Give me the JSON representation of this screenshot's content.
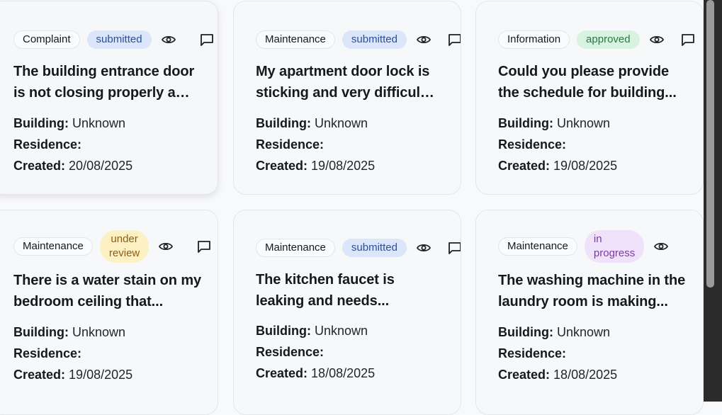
{
  "colors": {
    "submitted_bg": "#dbe6fb",
    "submitted_fg": "#2a4f9c",
    "approved_bg": "#d8f3df",
    "approved_fg": "#2a7a45",
    "under_review_bg": "#fdf1c4",
    "under_review_fg": "#8a5d12",
    "in_progress_bg": "#f1e2fb",
    "in_progress_fg": "#7a3aa5"
  },
  "labels": {
    "building": "Building:",
    "residence": "Residence:",
    "created": "Created:"
  },
  "cards": [
    {
      "category": "Complaint",
      "status": "submitted",
      "title_line1": "The building entrance door",
      "title_line2": "is not closing properly an...",
      "building": "Unknown",
      "residence": "",
      "created": "20/08/2025"
    },
    {
      "category": "Maintenance",
      "status": "submitted",
      "title_line1": "My apartment door lock is",
      "title_line2": "sticking and very difficult ...",
      "building": "Unknown",
      "residence": "",
      "created": "19/08/2025"
    },
    {
      "category": "Information",
      "status": "approved",
      "title_line1": "Could you please provide",
      "title_line2": "the schedule for building...",
      "building": "Unknown",
      "residence": "",
      "created": "19/08/2025"
    },
    {
      "category": "Maintenance",
      "status_line1": "under",
      "status_line2": "review",
      "title_line1": "There is a water stain on my",
      "title_line2": "bedroom ceiling that...",
      "building": "Unknown",
      "residence": "",
      "created": "19/08/2025"
    },
    {
      "category": "Maintenance",
      "status": "submitted",
      "title_line1": "The kitchen faucet is",
      "title_line2": "leaking and needs...",
      "building": "Unknown",
      "residence": "",
      "created": "18/08/2025"
    },
    {
      "category": "Maintenance",
      "status_line1": "in",
      "status_line2": "progress",
      "title_line1": "The washing machine in the",
      "title_line2": "laundry room is making...",
      "building": "Unknown",
      "residence": "",
      "created": "18/08/2025"
    }
  ],
  "icons": {
    "view": "eye-icon",
    "comment": "chat-bubble-icon"
  }
}
